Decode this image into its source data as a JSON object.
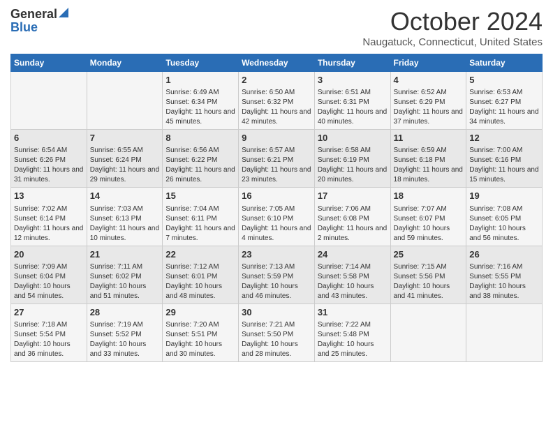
{
  "header": {
    "logo_general": "General",
    "logo_blue": "Blue",
    "month_title": "October 2024",
    "location": "Naugatuck, Connecticut, United States"
  },
  "days_of_week": [
    "Sunday",
    "Monday",
    "Tuesday",
    "Wednesday",
    "Thursday",
    "Friday",
    "Saturday"
  ],
  "weeks": [
    [
      {
        "day": "",
        "sunrise": "",
        "sunset": "",
        "daylight": ""
      },
      {
        "day": "",
        "sunrise": "",
        "sunset": "",
        "daylight": ""
      },
      {
        "day": "1",
        "sunrise": "Sunrise: 6:49 AM",
        "sunset": "Sunset: 6:34 PM",
        "daylight": "Daylight: 11 hours and 45 minutes."
      },
      {
        "day": "2",
        "sunrise": "Sunrise: 6:50 AM",
        "sunset": "Sunset: 6:32 PM",
        "daylight": "Daylight: 11 hours and 42 minutes."
      },
      {
        "day": "3",
        "sunrise": "Sunrise: 6:51 AM",
        "sunset": "Sunset: 6:31 PM",
        "daylight": "Daylight: 11 hours and 40 minutes."
      },
      {
        "day": "4",
        "sunrise": "Sunrise: 6:52 AM",
        "sunset": "Sunset: 6:29 PM",
        "daylight": "Daylight: 11 hours and 37 minutes."
      },
      {
        "day": "5",
        "sunrise": "Sunrise: 6:53 AM",
        "sunset": "Sunset: 6:27 PM",
        "daylight": "Daylight: 11 hours and 34 minutes."
      }
    ],
    [
      {
        "day": "6",
        "sunrise": "Sunrise: 6:54 AM",
        "sunset": "Sunset: 6:26 PM",
        "daylight": "Daylight: 11 hours and 31 minutes."
      },
      {
        "day": "7",
        "sunrise": "Sunrise: 6:55 AM",
        "sunset": "Sunset: 6:24 PM",
        "daylight": "Daylight: 11 hours and 29 minutes."
      },
      {
        "day": "8",
        "sunrise": "Sunrise: 6:56 AM",
        "sunset": "Sunset: 6:22 PM",
        "daylight": "Daylight: 11 hours and 26 minutes."
      },
      {
        "day": "9",
        "sunrise": "Sunrise: 6:57 AM",
        "sunset": "Sunset: 6:21 PM",
        "daylight": "Daylight: 11 hours and 23 minutes."
      },
      {
        "day": "10",
        "sunrise": "Sunrise: 6:58 AM",
        "sunset": "Sunset: 6:19 PM",
        "daylight": "Daylight: 11 hours and 20 minutes."
      },
      {
        "day": "11",
        "sunrise": "Sunrise: 6:59 AM",
        "sunset": "Sunset: 6:18 PM",
        "daylight": "Daylight: 11 hours and 18 minutes."
      },
      {
        "day": "12",
        "sunrise": "Sunrise: 7:00 AM",
        "sunset": "Sunset: 6:16 PM",
        "daylight": "Daylight: 11 hours and 15 minutes."
      }
    ],
    [
      {
        "day": "13",
        "sunrise": "Sunrise: 7:02 AM",
        "sunset": "Sunset: 6:14 PM",
        "daylight": "Daylight: 11 hours and 12 minutes."
      },
      {
        "day": "14",
        "sunrise": "Sunrise: 7:03 AM",
        "sunset": "Sunset: 6:13 PM",
        "daylight": "Daylight: 11 hours and 10 minutes."
      },
      {
        "day": "15",
        "sunrise": "Sunrise: 7:04 AM",
        "sunset": "Sunset: 6:11 PM",
        "daylight": "Daylight: 11 hours and 7 minutes."
      },
      {
        "day": "16",
        "sunrise": "Sunrise: 7:05 AM",
        "sunset": "Sunset: 6:10 PM",
        "daylight": "Daylight: 11 hours and 4 minutes."
      },
      {
        "day": "17",
        "sunrise": "Sunrise: 7:06 AM",
        "sunset": "Sunset: 6:08 PM",
        "daylight": "Daylight: 11 hours and 2 minutes."
      },
      {
        "day": "18",
        "sunrise": "Sunrise: 7:07 AM",
        "sunset": "Sunset: 6:07 PM",
        "daylight": "Daylight: 10 hours and 59 minutes."
      },
      {
        "day": "19",
        "sunrise": "Sunrise: 7:08 AM",
        "sunset": "Sunset: 6:05 PM",
        "daylight": "Daylight: 10 hours and 56 minutes."
      }
    ],
    [
      {
        "day": "20",
        "sunrise": "Sunrise: 7:09 AM",
        "sunset": "Sunset: 6:04 PM",
        "daylight": "Daylight: 10 hours and 54 minutes."
      },
      {
        "day": "21",
        "sunrise": "Sunrise: 7:11 AM",
        "sunset": "Sunset: 6:02 PM",
        "daylight": "Daylight: 10 hours and 51 minutes."
      },
      {
        "day": "22",
        "sunrise": "Sunrise: 7:12 AM",
        "sunset": "Sunset: 6:01 PM",
        "daylight": "Daylight: 10 hours and 48 minutes."
      },
      {
        "day": "23",
        "sunrise": "Sunrise: 7:13 AM",
        "sunset": "Sunset: 5:59 PM",
        "daylight": "Daylight: 10 hours and 46 minutes."
      },
      {
        "day": "24",
        "sunrise": "Sunrise: 7:14 AM",
        "sunset": "Sunset: 5:58 PM",
        "daylight": "Daylight: 10 hours and 43 minutes."
      },
      {
        "day": "25",
        "sunrise": "Sunrise: 7:15 AM",
        "sunset": "Sunset: 5:56 PM",
        "daylight": "Daylight: 10 hours and 41 minutes."
      },
      {
        "day": "26",
        "sunrise": "Sunrise: 7:16 AM",
        "sunset": "Sunset: 5:55 PM",
        "daylight": "Daylight: 10 hours and 38 minutes."
      }
    ],
    [
      {
        "day": "27",
        "sunrise": "Sunrise: 7:18 AM",
        "sunset": "Sunset: 5:54 PM",
        "daylight": "Daylight: 10 hours and 36 minutes."
      },
      {
        "day": "28",
        "sunrise": "Sunrise: 7:19 AM",
        "sunset": "Sunset: 5:52 PM",
        "daylight": "Daylight: 10 hours and 33 minutes."
      },
      {
        "day": "29",
        "sunrise": "Sunrise: 7:20 AM",
        "sunset": "Sunset: 5:51 PM",
        "daylight": "Daylight: 10 hours and 30 minutes."
      },
      {
        "day": "30",
        "sunrise": "Sunrise: 7:21 AM",
        "sunset": "Sunset: 5:50 PM",
        "daylight": "Daylight: 10 hours and 28 minutes."
      },
      {
        "day": "31",
        "sunrise": "Sunrise: 7:22 AM",
        "sunset": "Sunset: 5:48 PM",
        "daylight": "Daylight: 10 hours and 25 minutes."
      },
      {
        "day": "",
        "sunrise": "",
        "sunset": "",
        "daylight": ""
      },
      {
        "day": "",
        "sunrise": "",
        "sunset": "",
        "daylight": ""
      }
    ]
  ]
}
